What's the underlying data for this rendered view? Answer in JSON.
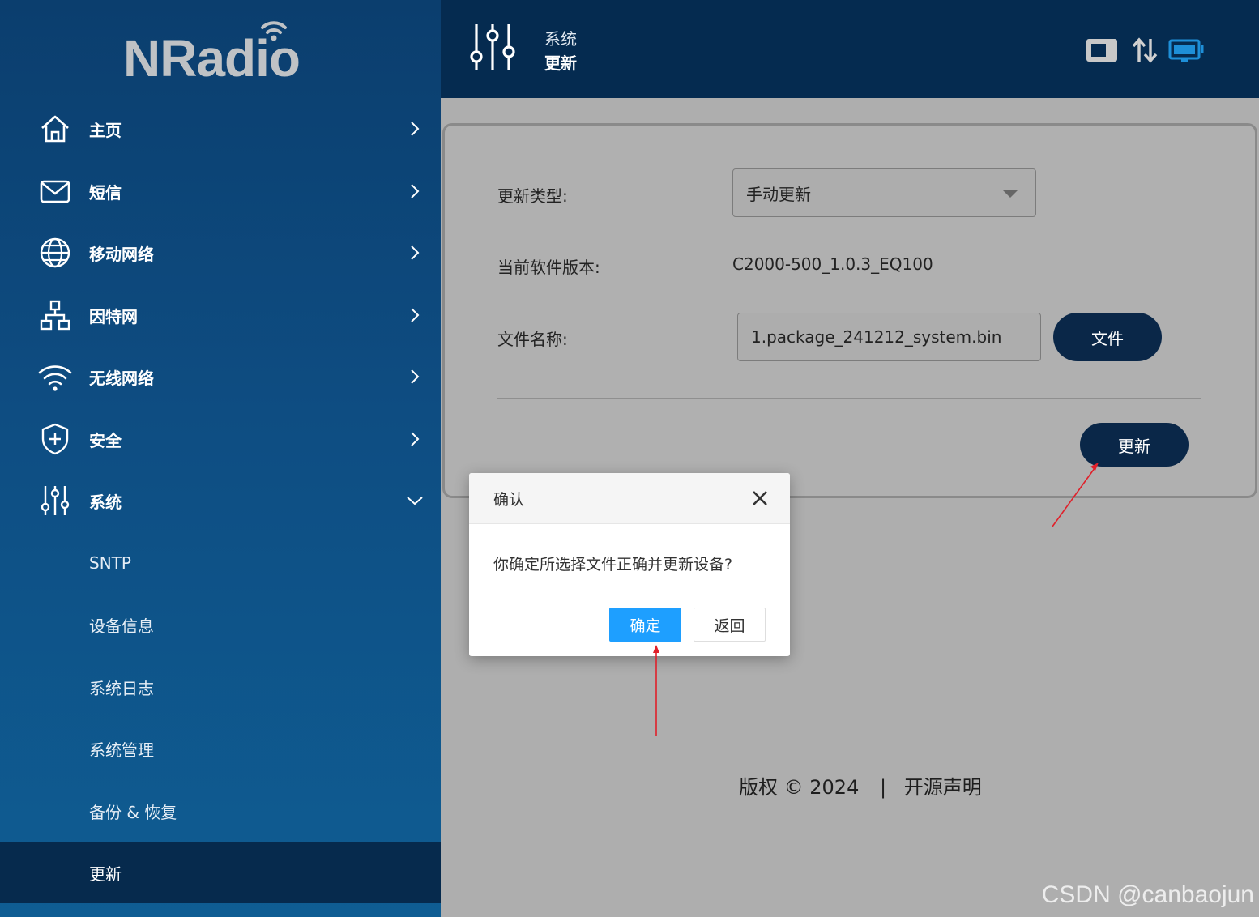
{
  "brand": {
    "logo_text": "NRadio"
  },
  "sidebar": {
    "items": [
      {
        "label": "主页",
        "icon": "home-icon"
      },
      {
        "label": "短信",
        "icon": "mail-icon"
      },
      {
        "label": "移动网络",
        "icon": "globe-icon"
      },
      {
        "label": "因特网",
        "icon": "network-icon"
      },
      {
        "label": "无线网络",
        "icon": "wifi-icon"
      },
      {
        "label": "安全",
        "icon": "shield-icon"
      },
      {
        "label": "系统",
        "icon": "sliders-icon",
        "expanded": true
      }
    ],
    "subitems": [
      {
        "label": "SNTP"
      },
      {
        "label": "设备信息"
      },
      {
        "label": "系统日志"
      },
      {
        "label": "系统管理"
      },
      {
        "label": "备份 & 恢复"
      },
      {
        "label": "更新",
        "active": true
      }
    ]
  },
  "header": {
    "section": "系统",
    "title": "更新",
    "status_icons": [
      "sim-card-icon",
      "transfer-arrows-icon",
      "display-icon"
    ]
  },
  "form": {
    "update_type_label": "更新类型:",
    "update_type_value": "手动更新",
    "version_label": "当前软件版本:",
    "version_value": "C2000-500_1.0.3_EQ100",
    "filename_label": "文件名称:",
    "filename_value": "1.package_241212_system.bin",
    "file_button": "文件",
    "update_button": "更新"
  },
  "footer": {
    "copyright": "版权 © 2024",
    "separator": "|",
    "link": "开源声明"
  },
  "dialog": {
    "title": "确认",
    "message": "你确定所选择文件正确并更新设备?",
    "ok_label": "确定",
    "back_label": "返回"
  },
  "watermark": "CSDN @canbaojun",
  "colors": {
    "sidebar": "#0e4d82",
    "header": "#052b50",
    "pill_button": "#0a2748",
    "ok_button": "#1e9fff",
    "annotation_arrow": "#e0202a"
  }
}
